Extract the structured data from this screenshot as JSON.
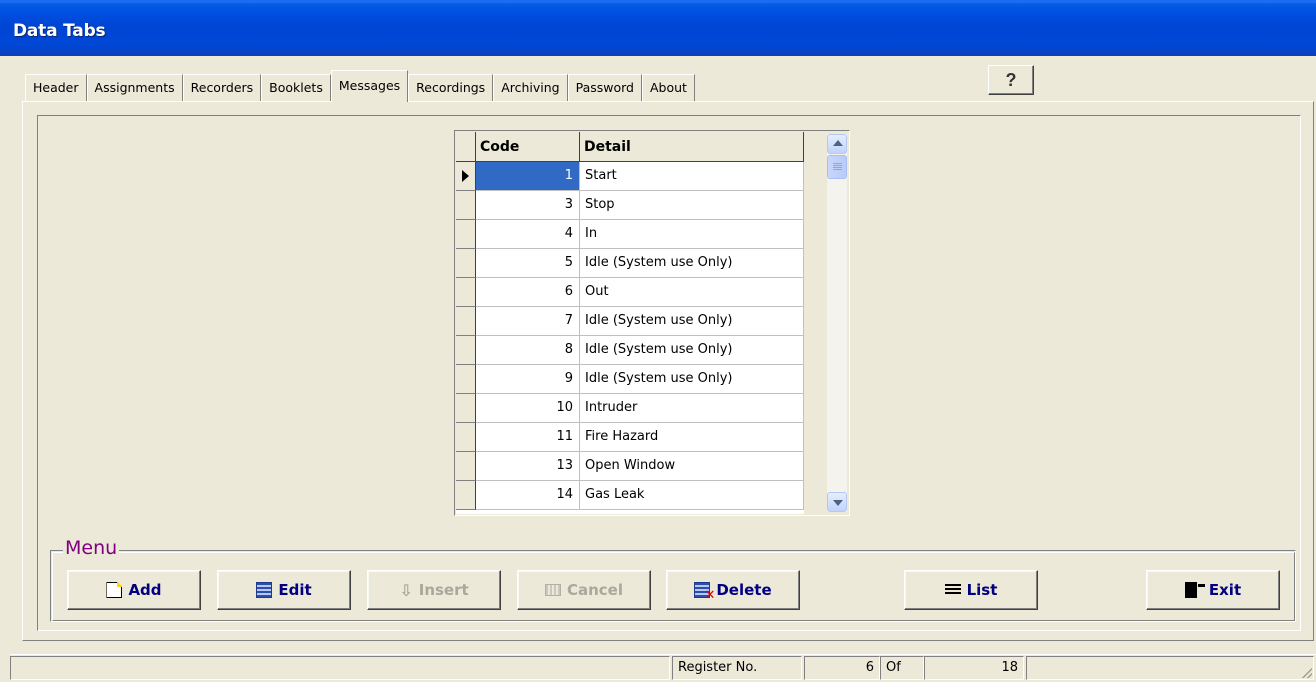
{
  "window": {
    "title": "Data Tabs"
  },
  "tabs": [
    {
      "label": "Header",
      "active": false
    },
    {
      "label": "Assignments",
      "active": false
    },
    {
      "label": "Recorders",
      "active": false
    },
    {
      "label": "Booklets",
      "active": false
    },
    {
      "label": "Messages",
      "active": true
    },
    {
      "label": "Recordings",
      "active": false
    },
    {
      "label": "Archiving",
      "active": false
    },
    {
      "label": "Password",
      "active": false
    },
    {
      "label": "About",
      "active": false
    }
  ],
  "help_button": {
    "icon": "question-icon",
    "label": "?"
  },
  "grid": {
    "columns": [
      "Code",
      "Detail"
    ],
    "current_row": 0,
    "rows": [
      {
        "code": "1",
        "detail": "Start"
      },
      {
        "code": "3",
        "detail": "Stop"
      },
      {
        "code": "4",
        "detail": "In"
      },
      {
        "code": "5",
        "detail": "Idle (System use Only)"
      },
      {
        "code": "6",
        "detail": "Out"
      },
      {
        "code": "7",
        "detail": "Idle (System use Only)"
      },
      {
        "code": "8",
        "detail": "Idle (System use Only)"
      },
      {
        "code": "9",
        "detail": "Idle (System use Only)"
      },
      {
        "code": "10",
        "detail": "Intruder"
      },
      {
        "code": "11",
        "detail": "Fire Hazard"
      },
      {
        "code": "13",
        "detail": "Open Window"
      },
      {
        "code": "14",
        "detail": "Gas Leak"
      }
    ]
  },
  "menu": {
    "legend": "Menu",
    "buttons": {
      "add": {
        "label": "Add",
        "enabled": true
      },
      "edit": {
        "label": "Edit",
        "enabled": true
      },
      "insert": {
        "label": "Insert",
        "enabled": false
      },
      "cancel": {
        "label": "Cancel",
        "enabled": false
      },
      "delete": {
        "label": "Delete",
        "enabled": true
      },
      "list": {
        "label": "List",
        "enabled": true
      },
      "exit": {
        "label": "Exit",
        "enabled": true
      }
    }
  },
  "status": {
    "register_label": "Register No.",
    "current": "6",
    "of_label": "Of",
    "total": "18"
  },
  "colors": {
    "titlebar": "#0046d5",
    "selection": "#316ac5",
    "menu_legend": "#800080",
    "button_text": "#000080"
  }
}
